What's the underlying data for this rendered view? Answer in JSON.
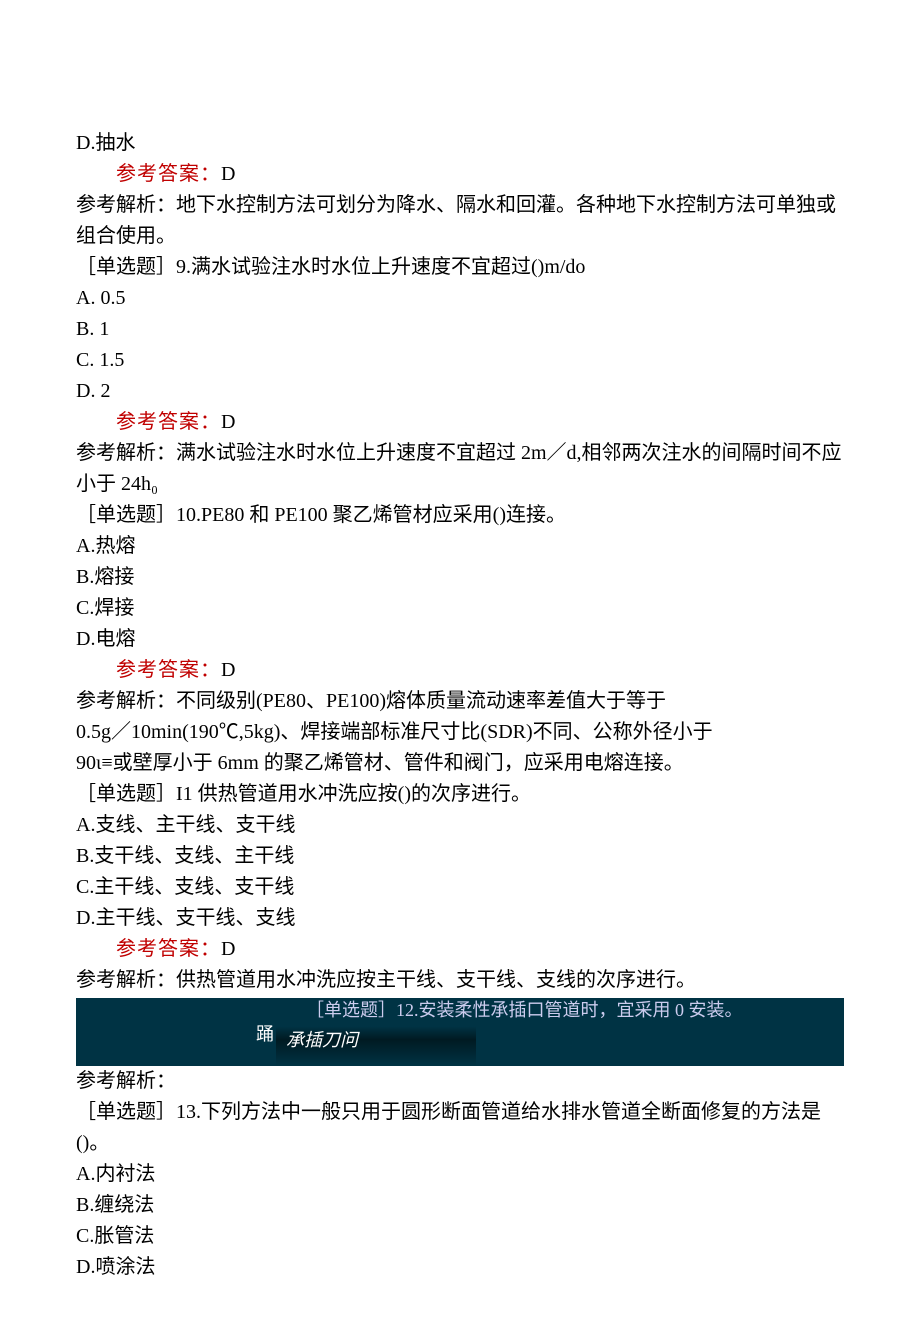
{
  "q8": {
    "optD": "D.抽水",
    "ansLabel": "参考答案：",
    "ans": "D",
    "explain": "参考解析：地下水控制方法可划分为降水、隔水和回灌。各种地下水控制方法可单独或组合使用。"
  },
  "q9": {
    "stem": "［单选题］9.满水试验注水时水位上升速度不宜超过()m/do",
    "optA": "A.  0.5",
    "optB": "B.  1",
    "optC": "C.  1.5",
    "optD": "D.  2",
    "ansLabel": "参考答案：",
    "ans": "D",
    "explain": "参考解析：满水试验注水时水位上升速度不宜超过 2m／d,相邻两次注水的间隔时间不应小于 24h₀"
  },
  "q10": {
    "stem": "［单选题］10.PE80 和 PE100 聚乙烯管材应采用()连接。",
    "optA": "A.热熔",
    "optB": "B.熔接",
    "optC": "C.焊接",
    "optD": "D.电熔",
    "ansLabel": "参考答案：",
    "ans": "D",
    "explain1": "参考解析：不同级别(PE80、PE100)熔体质量流动速率差值大于等于",
    "explain2": "0.5g／10min(190℃,5kg)、焊接端部标准尺寸比(SDR)不同、公称外径小于",
    "explain3": "90ι≡或壁厚小于 6mm 的聚乙烯管材、管件和阀门，应采用电熔连接。"
  },
  "q11": {
    "stem": "［单选题］I1 供热管道用水冲洗应按()的次序进行。",
    "optA": "A.支线、主干线、支干线",
    "optB": "B.支干线、支线、主干线",
    "optC": "C.主干线、支线、支干线",
    "optD": "D.主干线、支干线、支线",
    "ansLabel": "参考答案：",
    "ans": "D",
    "explain": "参考解析：供热管道用水冲洗应按主干线、支干线、支线的次序进行。"
  },
  "q12": {
    "hlTop": "［单选题］12.安装柔性承插口管道时，宜采用 0 安装。",
    "hlLeft": "踊",
    "hlMid": "承插刀问"
  },
  "q13": {
    "explainLabel": "参考解析：",
    "stem": "［单选题］13.下列方法中一般只用于圆形断面管道给水排水管道全断面修复的方法是()。",
    "optA": "A.内衬法",
    "optB": "B.缠绕法",
    "optC": "C.胀管法",
    "optD": "D.喷涂法"
  }
}
